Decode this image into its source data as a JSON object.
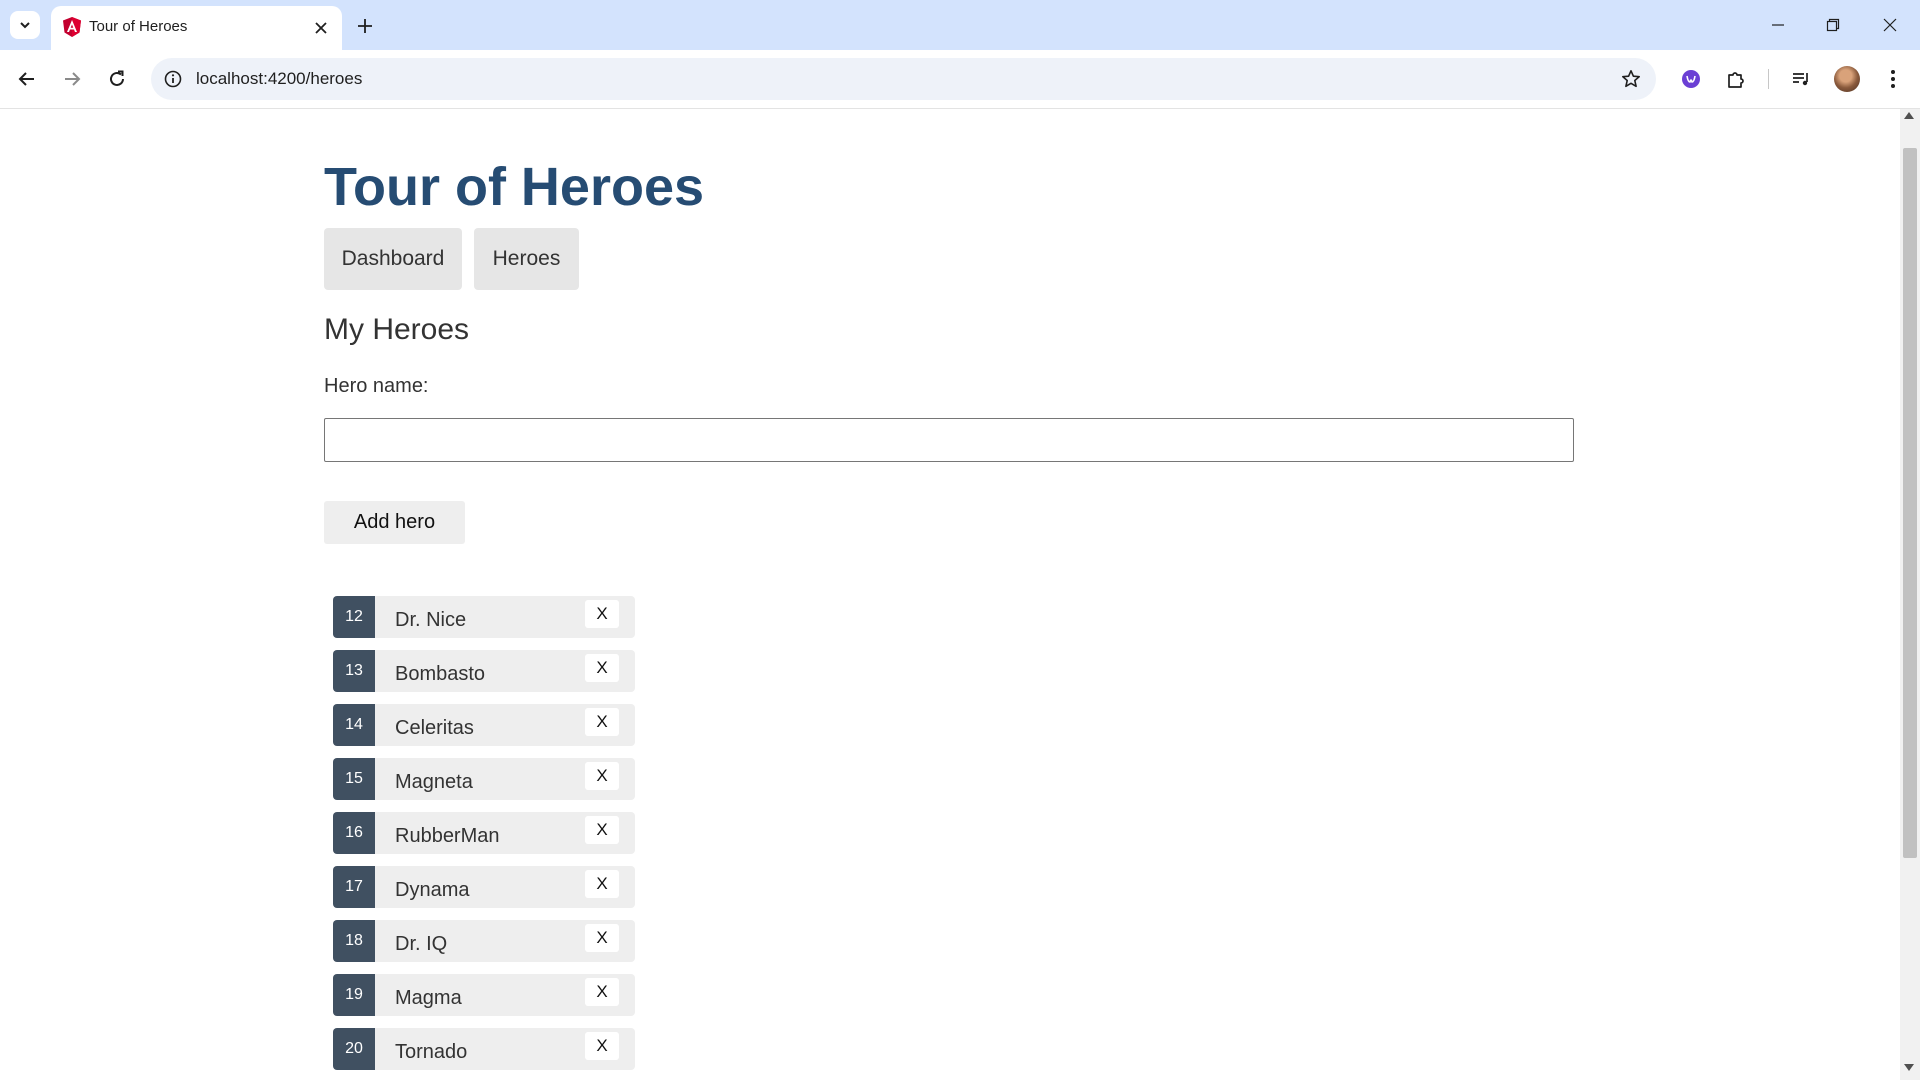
{
  "browser": {
    "tab_title": "Tour of Heroes",
    "url": "localhost:4200/heroes",
    "accent_color": "#d3e3fd"
  },
  "app": {
    "title": "Tour of Heroes",
    "title_color": "#264c73",
    "nav": [
      {
        "label": "Dashboard"
      },
      {
        "label": "Heroes"
      }
    ],
    "section_title": "My Heroes",
    "hero_name_label": "Hero name:",
    "hero_name_value": "",
    "add_button_label": "Add hero",
    "delete_label": "X",
    "heroes": [
      {
        "id": "12",
        "name": "Dr. Nice"
      },
      {
        "id": "13",
        "name": "Bombasto"
      },
      {
        "id": "14",
        "name": "Celeritas"
      },
      {
        "id": "15",
        "name": "Magneta"
      },
      {
        "id": "16",
        "name": "RubberMan"
      },
      {
        "id": "17",
        "name": "Dynama"
      },
      {
        "id": "18",
        "name": "Dr. IQ"
      },
      {
        "id": "19",
        "name": "Magma"
      },
      {
        "id": "20",
        "name": "Tornado"
      }
    ],
    "badge_color": "#405061"
  }
}
